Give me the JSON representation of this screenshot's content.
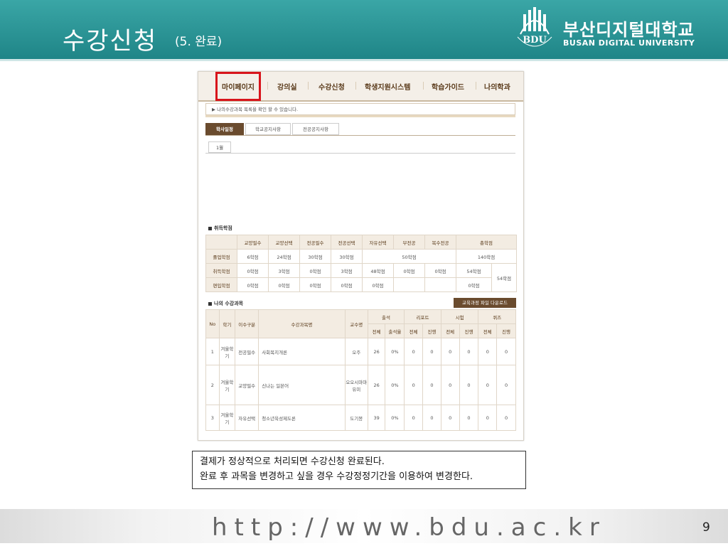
{
  "slide": {
    "title": "수강신청",
    "subtitle": "(5. 완료)",
    "logo_ko": "부산디지털대학교",
    "logo_en": "BUSAN DIGITAL UNIVERSITY",
    "logo_mark": "BDU",
    "caption_line1": "결제가 정상적으로 처리되면 수강신청 완료된다.",
    "caption_line2": "완료 후 과목을 변경하고 싶을 경우 수강정정기간을 이용하여 변경한다.",
    "footer_url": "http://www.bdu.ac.kr",
    "page_number": "9",
    "colors": {
      "header": "#2a9494",
      "highlight": "#d8141b",
      "brown": "#6a4b2e"
    }
  },
  "nav": {
    "items": [
      "마이페이지",
      "강의실",
      "수강신청",
      "학생지원시스템",
      "학습가이드",
      "나의학과"
    ]
  },
  "notice": "▶ 나의수강과목 목록을 확인 할 수 있습니다.",
  "tabs": [
    "학사일정",
    "학교공지사항",
    "전공공지사항"
  ],
  "month_tab": "1월",
  "credits": {
    "title": "취득학점",
    "headers": [
      "",
      "교양필수",
      "교양선택",
      "전공필수",
      "전공선택",
      "자유선택",
      "부전공",
      "복수전공",
      "총학점"
    ],
    "rows": [
      {
        "label": "졸업학점",
        "cells": [
          "6학점",
          "24학점",
          "30학점",
          "30학점",
          "50학점",
          "140학점"
        ]
      },
      {
        "label": "취득학점",
        "cells": [
          "0학점",
          "3학점",
          "0학점",
          "3학점",
          "48학점",
          "0학점",
          "0학점",
          "54학점"
        ]
      },
      {
        "label": "편입학점",
        "cells": [
          "0학점",
          "0학점",
          "0학점",
          "0학점",
          "0학점",
          "",
          "",
          "0학점"
        ]
      }
    ],
    "total_merged": "54학점"
  },
  "courses": {
    "title": "나의 수강과목",
    "download_label": "교육과정 파일 다운로드",
    "headers": {
      "no": "No",
      "term": "학기",
      "type": "이수구분",
      "name": "수강과목명",
      "prof": "교수명",
      "attend": "출석",
      "report": "리포트",
      "exam": "시험",
      "quiz": "퀴즈",
      "total": "전체",
      "rate": "출석율",
      "progress": "진행"
    },
    "rows": [
      {
        "no": "1",
        "term": "겨울학기",
        "type": "전공필수",
        "name": "사회복지개론",
        "prof": "오주",
        "att_total": "26",
        "att_rate": "0%",
        "rep_total": "0",
        "rep_prog": "0",
        "exam_total": "0",
        "exam_prog": "0",
        "quiz_total": "0",
        "quiz_prog": "0"
      },
      {
        "no": "2",
        "term": "겨울학기",
        "type": "교양필수",
        "name": "신나는 일본어",
        "prof": "오오시마마유미",
        "att_total": "26",
        "att_rate": "0%",
        "rep_total": "0",
        "rep_prog": "0",
        "exam_total": "0",
        "exam_prog": "0",
        "quiz_total": "0",
        "quiz_prog": "0"
      },
      {
        "no": "3",
        "term": "겨울학기",
        "type": "자유선택",
        "name": "청소년육성제도론",
        "prof": "도기봉",
        "att_total": "39",
        "att_rate": "0%",
        "rep_total": "0",
        "rep_prog": "0",
        "exam_total": "0",
        "exam_prog": "0",
        "quiz_total": "0",
        "quiz_prog": "0"
      }
    ]
  }
}
